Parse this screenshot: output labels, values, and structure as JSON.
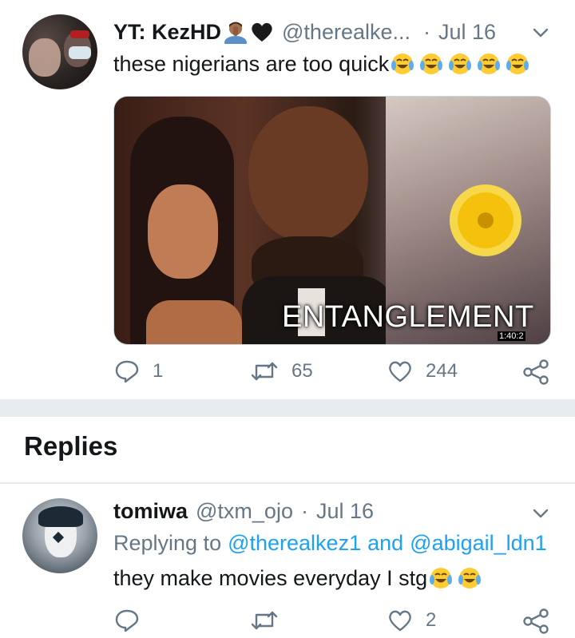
{
  "tweet": {
    "display_name": "YT: KezHD",
    "handle": "@therealke...",
    "separator": "·",
    "date": "Jul 16",
    "text": "these nigerians are too quick",
    "media_caption": "ENTANGLEMENT",
    "media_duration": "1:40:2",
    "reply_count": "1",
    "retweet_count": "65",
    "like_count": "244"
  },
  "section": {
    "replies_heading": "Replies"
  },
  "reply": {
    "display_name": "tomiwa",
    "handle": "@txm_ojo",
    "separator": "·",
    "date": "Jul 16",
    "replying_to_prefix": "Replying to",
    "mention_1": "@therealkez1",
    "and_word": "and",
    "mention_2": "@abigail_ldn1",
    "text": "they make movies everyday I stg",
    "like_count": "2"
  },
  "colors": {
    "accent": "#1da1f2",
    "muted": "#657786",
    "divider": "#e6ecf0"
  },
  "icons": {
    "reply": "reply-icon",
    "retweet": "retweet-icon",
    "like": "heart-icon",
    "share": "share-icon",
    "menu": "chevron-down-icon",
    "emoji": "face-with-tears-of-joy-emoji",
    "person_emoji": "person-facepalming-emoji",
    "heart_emoji": "black-heart-emoji"
  }
}
